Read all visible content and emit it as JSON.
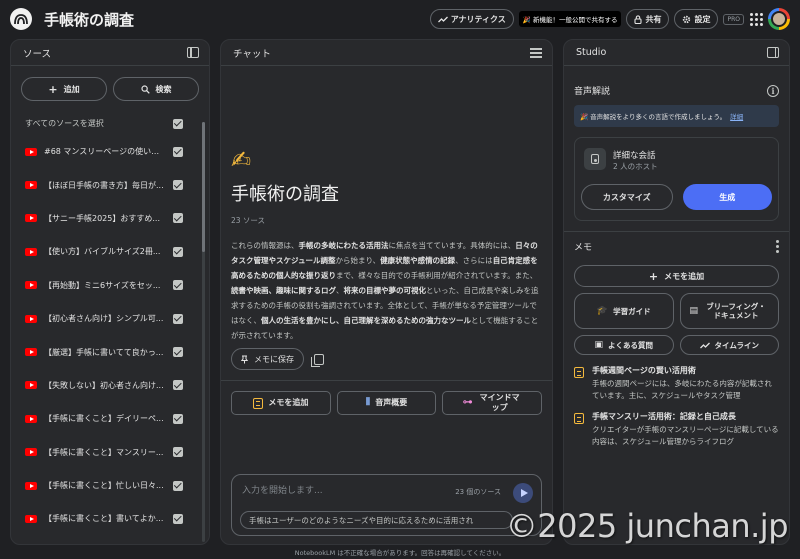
{
  "header": {
    "title": "手帳術の調査",
    "analytics_label": "アナリティクス",
    "new_feature_label": "🎉 新機能！一般公開で共有する",
    "share_label": "共有",
    "settings_label": "設定",
    "plan_badge": "PRO"
  },
  "sources": {
    "title": "ソース",
    "add_label": "追加",
    "search_label": "検索",
    "select_all_label": "すべてのソースを選択",
    "items": [
      {
        "label": "#68 マンスリーページの使い方..."
      },
      {
        "label": "【ほぼ日手帳の書き方】毎日が..."
      },
      {
        "label": "【サニー手帳2025】おすすめ..."
      },
      {
        "label": "【使い方】バイブルサイズ2冊..."
      },
      {
        "label": "【再始動】ミニ6サイズをセッ..."
      },
      {
        "label": "【初心者さん向け】シンプル可..."
      },
      {
        "label": "【厳選】手帳に書いてて良かっ..."
      },
      {
        "label": "【失敗しない】初心者さん向け..."
      },
      {
        "label": "【手帳に書くこと】デイリーペ..."
      },
      {
        "label": "【手帳に書くこと】マンスリー..."
      },
      {
        "label": "【手帳に書くこと】忙しい日々..."
      },
      {
        "label": "【手帳に書くこと】書いてよか..."
      }
    ]
  },
  "chat": {
    "title": "チャット",
    "emoji": "✍",
    "notebook_title": "手帳術の調査",
    "source_count": "23 ソース",
    "summary": {
      "p1": "これらの情報源は、",
      "b1": "手帳の多岐にわたる活用法",
      "p2": "に焦点を当てています。具体的には、",
      "b2": "日々のタスク管理やスケジュール調整",
      "p3": "から始まり、",
      "b3": "健康状態や感情の記録",
      "p4": "、さらには",
      "b4": "自己肯定感を高めるための個人的な振り返り",
      "p5": "まで、様々な目的での手帳利用が紹介されています。また、",
      "b5": "読書や映画、趣味に関するログ",
      "p6": "、",
      "b6": "将来の目標や夢の可視化",
      "p7": "といった、自己成長や楽しみを追求するための手帳の役割も強調されています。全体として、手帳が単なる予定管理ツールではなく、",
      "b7": "個人の生活を豊かにし、自己理解を深めるための強力なツール",
      "p8": "として機能することが示されています。"
    },
    "save_label": "メモに保存",
    "actions": {
      "add_memo": "メモを追加",
      "audio_overview": "音声概要",
      "mindmap": "マインドマップ"
    },
    "input_placeholder": "入力を開始します...",
    "input_source_count": "23 個のソース",
    "suggestion": "手帳はユーザーのどのようなニーズや目的に応えるために活用され"
  },
  "studio": {
    "title": "Studio",
    "audio_section_title": "音声解説",
    "banner_text": "🎉 音声解説をより多くの言語で作成しましょう。",
    "banner_link": "詳細",
    "audio_card_title": "詳細な会話",
    "audio_card_sub": "2 人のホスト",
    "customize_label": "カスタマイズ",
    "generate_label": "生成",
    "memo_title": "メモ",
    "add_memo_label": "メモを追加",
    "study_guide": "学習ガイド",
    "briefing_doc": "ブリーフィング・ドキュメント",
    "faq": "よくある質問",
    "timeline": "タイムライン",
    "notes": [
      {
        "title": "手帳週間ページの賢い活用術",
        "text": "手帳の週間ページには、多岐にわたる内容が記載されています。主に、スケジュールやタスク管理"
      },
      {
        "title": "手帳マンスリー活用術：記録と自己成長",
        "text": "クリエイターが手帳のマンスリーページに記載している内容は、スケジュール管理からライフログ"
      }
    ]
  },
  "footer": {
    "disclaimer": "NotebookLM は不正確な場合があります。回答は再確認してください。"
  },
  "watermark": "©2025 junchan.jp"
}
